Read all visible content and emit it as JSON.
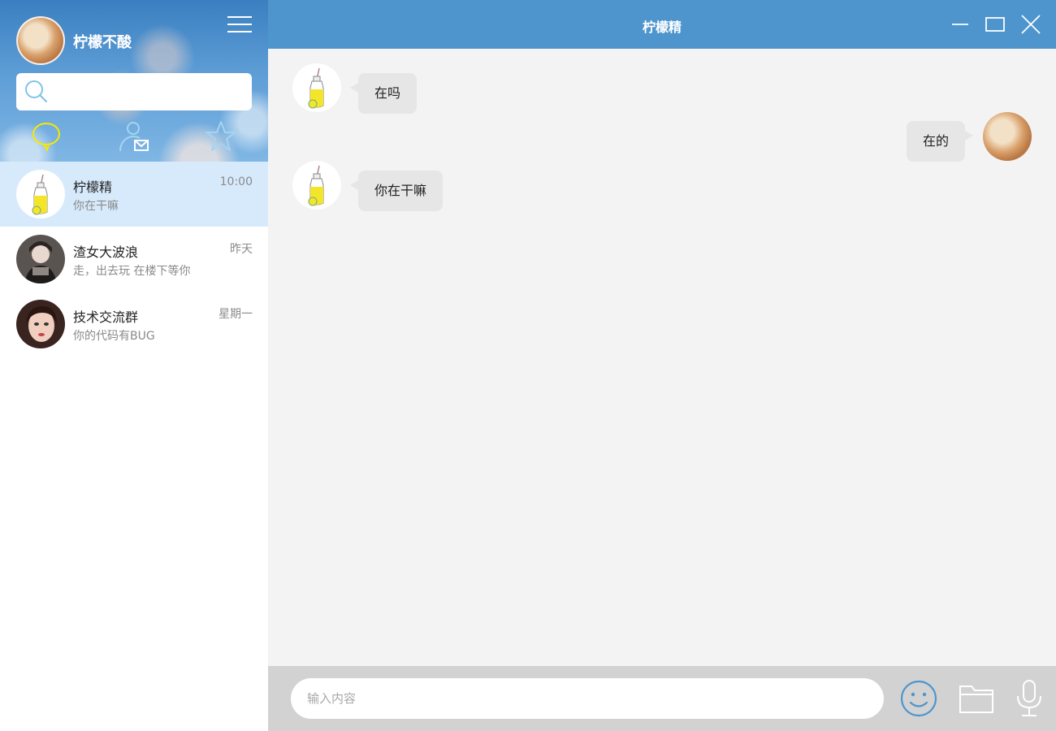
{
  "profile": {
    "name": "柠檬不酸",
    "avatar": "cat-dog-avatar"
  },
  "search": {
    "placeholder": "",
    "value": ""
  },
  "nav_tabs": [
    {
      "name": "chat",
      "icon": "chat-bubble-icon",
      "color": "#f5e900",
      "active": true
    },
    {
      "name": "contacts",
      "icon": "contact-mail-icon",
      "color": "#9fd0f0",
      "active": false
    },
    {
      "name": "favorites",
      "icon": "star-icon",
      "color": "#9fd0f0",
      "active": false
    }
  ],
  "conversations": [
    {
      "name": "柠檬精",
      "preview": "你在干嘛",
      "time": "10:00",
      "avatar": "lemon-bottle-avatar",
      "active": true
    },
    {
      "name": "渣女大波浪",
      "preview": "走，出去玩 在楼下等你",
      "time": "昨天",
      "avatar": "girl-photo-avatar",
      "active": false
    },
    {
      "name": "技术交流群",
      "preview": "你的代码有BUG",
      "time": "星期一",
      "avatar": "girl-drawing-avatar",
      "active": false
    }
  ],
  "chat": {
    "title": "柠檬精",
    "messages": [
      {
        "side": "left",
        "text": "在吗",
        "avatar": "lemon-bottle-avatar"
      },
      {
        "side": "right",
        "text": "在的",
        "avatar": "cat-dog-avatar"
      },
      {
        "side": "left",
        "text": "你在干嘛",
        "avatar": "lemon-bottle-avatar"
      }
    ]
  },
  "composer": {
    "placeholder": "输入内容",
    "value": "",
    "tools": [
      "emoji-icon",
      "folder-icon",
      "microphone-icon"
    ]
  },
  "colors": {
    "titlebar": "#4e95cd",
    "active_conversation": "#d7eafc",
    "chat_background": "#f3f3f3",
    "bubble": "#e6e6e6",
    "input_bar": "#d2d2d2",
    "emoji_icon": "#4e95cd"
  }
}
